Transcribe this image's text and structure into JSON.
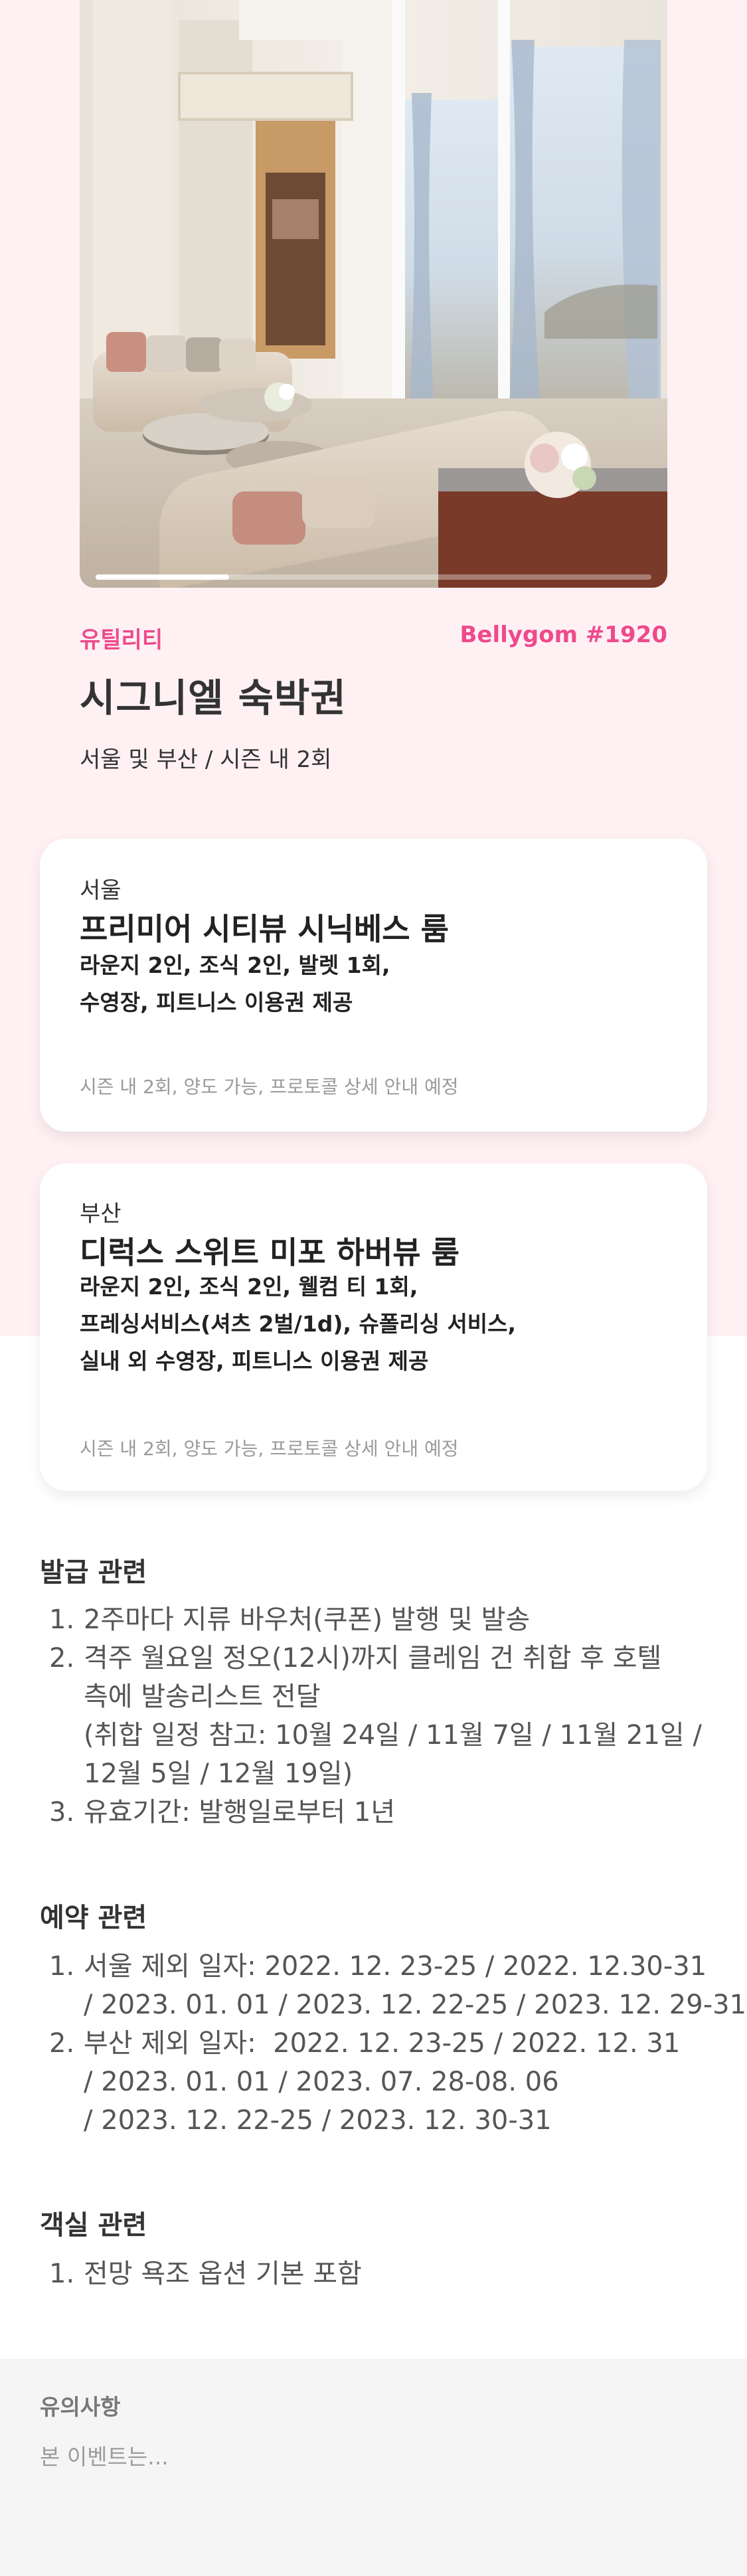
{
  "hero": {
    "slide_progress": 0.24
  },
  "product": {
    "category": "유틸리티",
    "token_id": "Bellygom #1920",
    "title": "시그니엘 숙박권",
    "subtitle": "서울 및 부산 / 시즌 내 2회"
  },
  "cards": [
    {
      "city": "서울",
      "room": "프리미어 시티뷰 시닉베스 룸",
      "desc_lines": [
        "라운지 2인, 조식 2인, 발렛 1회,",
        "수영장, 피트니스 이용권 제공"
      ],
      "note": "시즌 내 2회, 양도 가능, 프로토콜 상세 안내 예정"
    },
    {
      "city": "부산",
      "room": "디럭스 스위트 미포 하버뷰 룸",
      "desc_lines": [
        "라운지 2인, 조식 2인, 웰컴 티 1회,",
        "프레싱서비스(셔츠 2벌/1d), 슈폴리싱 서비스,",
        "실내 외 수영장, 피트니스 이용권 제공"
      ],
      "note": "시즌 내 2회, 양도 가능, 프로토콜 상세 안내 예정"
    }
  ],
  "issuance": {
    "title": "발급 관련",
    "items": [
      {
        "num": "1.",
        "lines": [
          "2주마다 지류 바우처(쿠폰) 발행 및 발송"
        ]
      },
      {
        "num": "2.",
        "lines": [
          "격주 월요일 정오(12시)까지 클레임 건 취합 후 호텔",
          "측에 발송리스트 전달",
          "(취합 일정 참고: 10월 24일 / 11월 7일 / 11월 21일 /",
          "12월 5일 / 12월 19일)"
        ]
      },
      {
        "num": "3.",
        "lines": [
          "유효기간: 발행일로부터 1년"
        ]
      }
    ]
  },
  "reservation": {
    "title": "예약 관련",
    "items": [
      {
        "num": "1.",
        "lines": [
          "서울 제외 일자: 2022. 12. 23-25 / 2022. 12.30-31",
          "/ 2023. 01. 01 / 2023. 12. 22-25 / 2023. 12. 29-31"
        ]
      },
      {
        "num": "2.",
        "lines": [
          "부산 제외 일자:  2022. 12. 23-25 / 2022. 12. 31",
          "/ 2023. 01. 01 / 2023. 07. 28-08. 06",
          "/ 2023. 12. 22-25 / 2023. 12. 30-31"
        ]
      }
    ]
  },
  "room": {
    "title": "객실 관련",
    "items": [
      {
        "num": "1.",
        "lines": [
          "전망 욕조 옵션 기본 포함"
        ]
      }
    ]
  },
  "notice": {
    "title": "유의사항",
    "text": "본 이벤트는..."
  }
}
